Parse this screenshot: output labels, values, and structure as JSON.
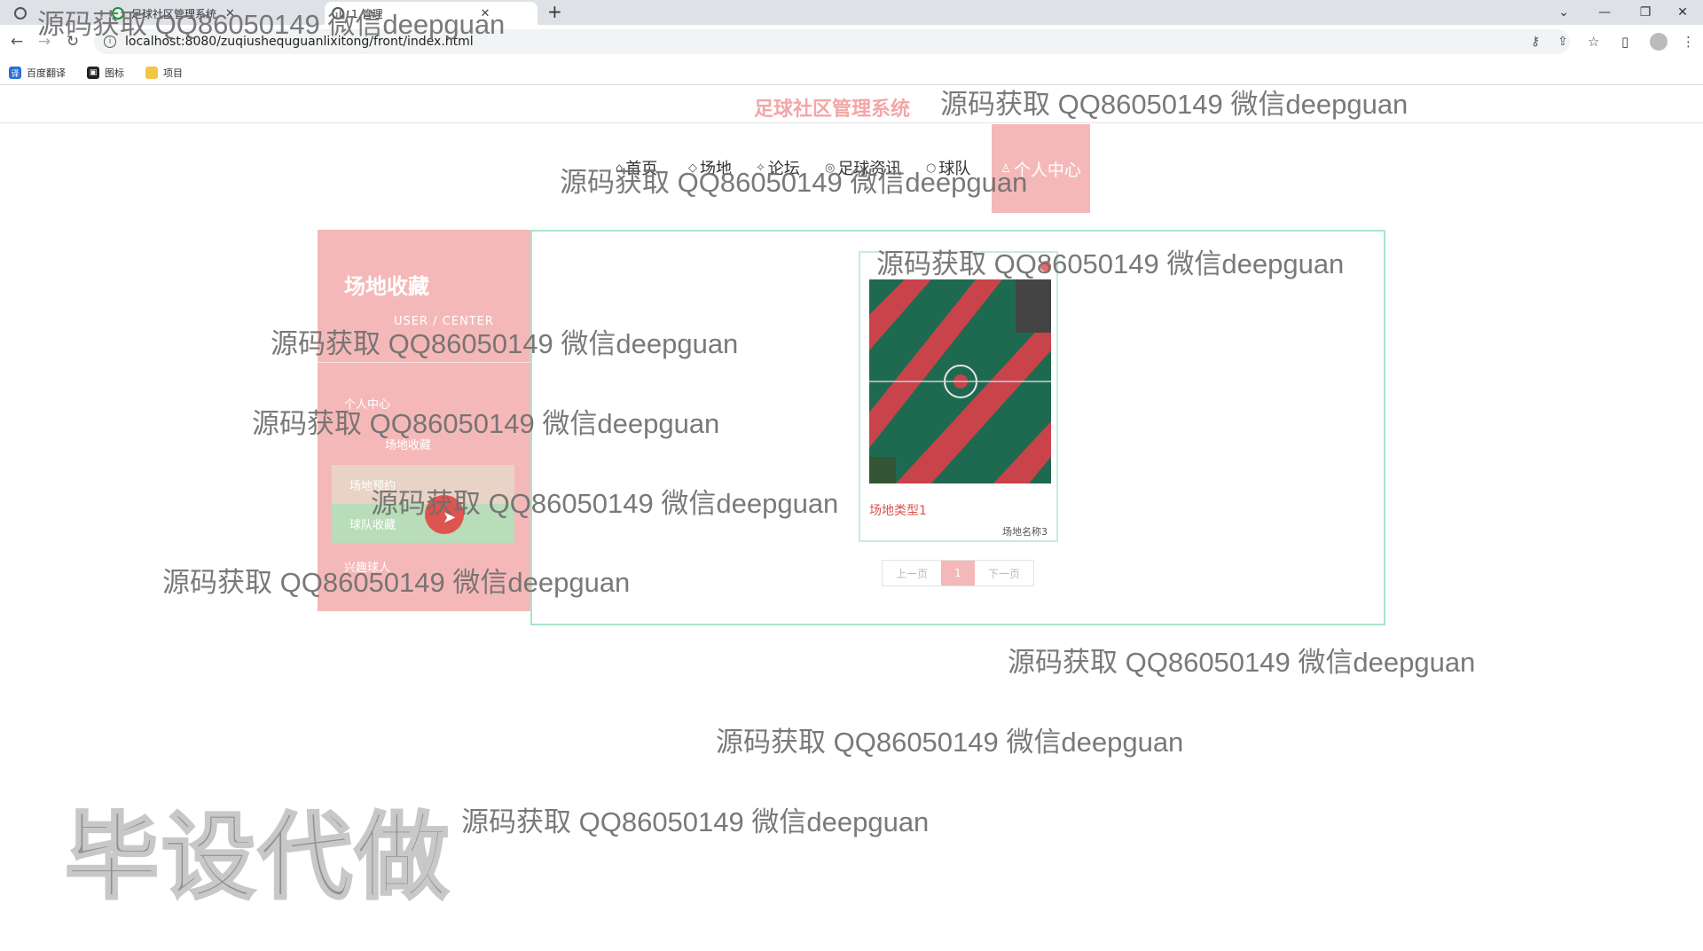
{
  "browser": {
    "tabs": [
      {
        "title": "足球社区管理系统"
      },
      {
        "title": "1.管理"
      }
    ],
    "new_tab": "+",
    "window_controls": {
      "minimize": "—",
      "restore": "❐",
      "close": "✕"
    },
    "url": "localhost:8080/zuqiushequguanlixitong/front/index.html",
    "bookmarks": [
      {
        "label": "百度翻译",
        "color": "#2a6fdb"
      },
      {
        "label": "图标",
        "color": "#222222"
      },
      {
        "label": "项目",
        "color": "#f4c542"
      }
    ]
  },
  "site": {
    "title": "足球社区管理系统",
    "nav": [
      {
        "label": "首页",
        "icon": "home-icon"
      },
      {
        "label": "场地",
        "icon": "field-icon"
      },
      {
        "label": "论坛",
        "icon": "forum-icon"
      },
      {
        "label": "足球资讯",
        "icon": "news-icon"
      },
      {
        "label": "球队",
        "icon": "team-icon"
      }
    ],
    "nav_active": "个人中心"
  },
  "sidebar": {
    "title": "场地收藏",
    "subtitle": "USER / CENTER",
    "items": [
      {
        "label": "个人中心"
      },
      {
        "label": "场地收藏"
      },
      {
        "label": "场地预约"
      },
      {
        "label": "球队收藏"
      },
      {
        "label": "兴趣球人"
      }
    ]
  },
  "main": {
    "cards": [
      {
        "type": "场地类型1",
        "name": "场地名称3"
      }
    ],
    "pager": {
      "prev": "上一页",
      "current": "1",
      "next": "下一页"
    }
  },
  "watermarks": {
    "text": "源码获取 QQ86050149 微信deepguan",
    "big": "毕设代做"
  },
  "colors": {
    "accent_pink": "#f5b8b8",
    "border_green": "#a8e6c7",
    "type_red": "#d9534f"
  }
}
